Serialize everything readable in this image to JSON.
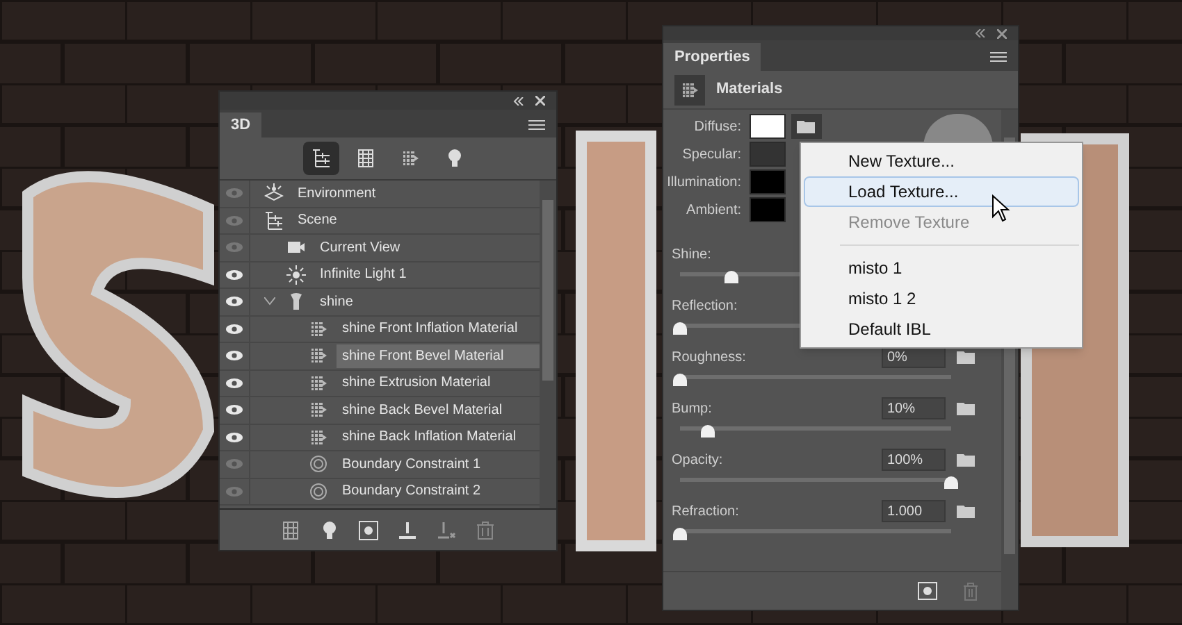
{
  "panel_3d": {
    "tab": "3D",
    "tools": [
      {
        "kind": "scene",
        "selected": true
      },
      {
        "kind": "mesh",
        "selected": false
      },
      {
        "kind": "material",
        "selected": false
      },
      {
        "kind": "light",
        "selected": false
      }
    ],
    "tree": [
      {
        "label": "Environment",
        "kind": "environment",
        "visible": false,
        "selected": false
      },
      {
        "label": "Scene",
        "kind": "scene",
        "visible": false,
        "selected": false,
        "children": [
          {
            "label": "Current View",
            "kind": "camera",
            "visible": false,
            "selected": false
          },
          {
            "label": "Infinite Light 1",
            "kind": "light",
            "visible": true,
            "selected": false
          },
          {
            "label": "shine",
            "kind": "mesh",
            "visible": true,
            "selected": false,
            "expanded": true,
            "children": [
              {
                "label": "shine Front Inflation Material",
                "kind": "material",
                "visible": true,
                "selected": false
              },
              {
                "label": "shine Front Bevel Material",
                "kind": "material",
                "visible": true,
                "selected": true
              },
              {
                "label": "shine Extrusion Material",
                "kind": "material",
                "visible": true,
                "selected": false
              },
              {
                "label": "shine Back Bevel Material",
                "kind": "material",
                "visible": true,
                "selected": false
              },
              {
                "label": "shine Back Inflation Material",
                "kind": "material",
                "visible": true,
                "selected": false
              },
              {
                "label": "Boundary Constraint 1",
                "kind": "constraint",
                "visible": false,
                "selected": false
              },
              {
                "label": "Boundary Constraint 2",
                "kind": "constraint",
                "visible": false,
                "selected": false
              }
            ]
          }
        ]
      }
    ]
  },
  "properties": {
    "tab": "Properties",
    "section": "Materials",
    "colors": [
      {
        "label": "Diffuse:",
        "color": "#ffffff"
      },
      {
        "label": "Specular:",
        "color": "#333333"
      },
      {
        "label": "Illumination:",
        "color": "#000000"
      },
      {
        "label": "Ambient:",
        "color": "#000000"
      }
    ],
    "sliders": [
      {
        "label": "Shine:",
        "level": 0.19
      },
      {
        "label": "Reflection:",
        "level": 0
      },
      {
        "label": "Roughness:",
        "level": 0,
        "value": "0%"
      },
      {
        "label": "Bump:",
        "level": 0.1,
        "value": "10%"
      },
      {
        "label": "Opacity:",
        "level": 1,
        "value": "100%"
      },
      {
        "label": "Refraction:",
        "level": 0,
        "value": "1.000"
      }
    ]
  },
  "menu": {
    "groups": [
      [
        {
          "label": "New Texture...",
          "highlighted": false,
          "disabled": false
        },
        {
          "label": "Load Texture...",
          "highlighted": true,
          "disabled": false
        },
        {
          "label": "Remove Texture",
          "highlighted": false,
          "disabled": true
        }
      ],
      [
        {
          "label": "misto 1",
          "highlighted": false,
          "disabled": false
        },
        {
          "label": "misto 1 2",
          "highlighted": false,
          "disabled": false
        },
        {
          "label": "Default IBL",
          "highlighted": false,
          "disabled": false
        }
      ]
    ]
  }
}
